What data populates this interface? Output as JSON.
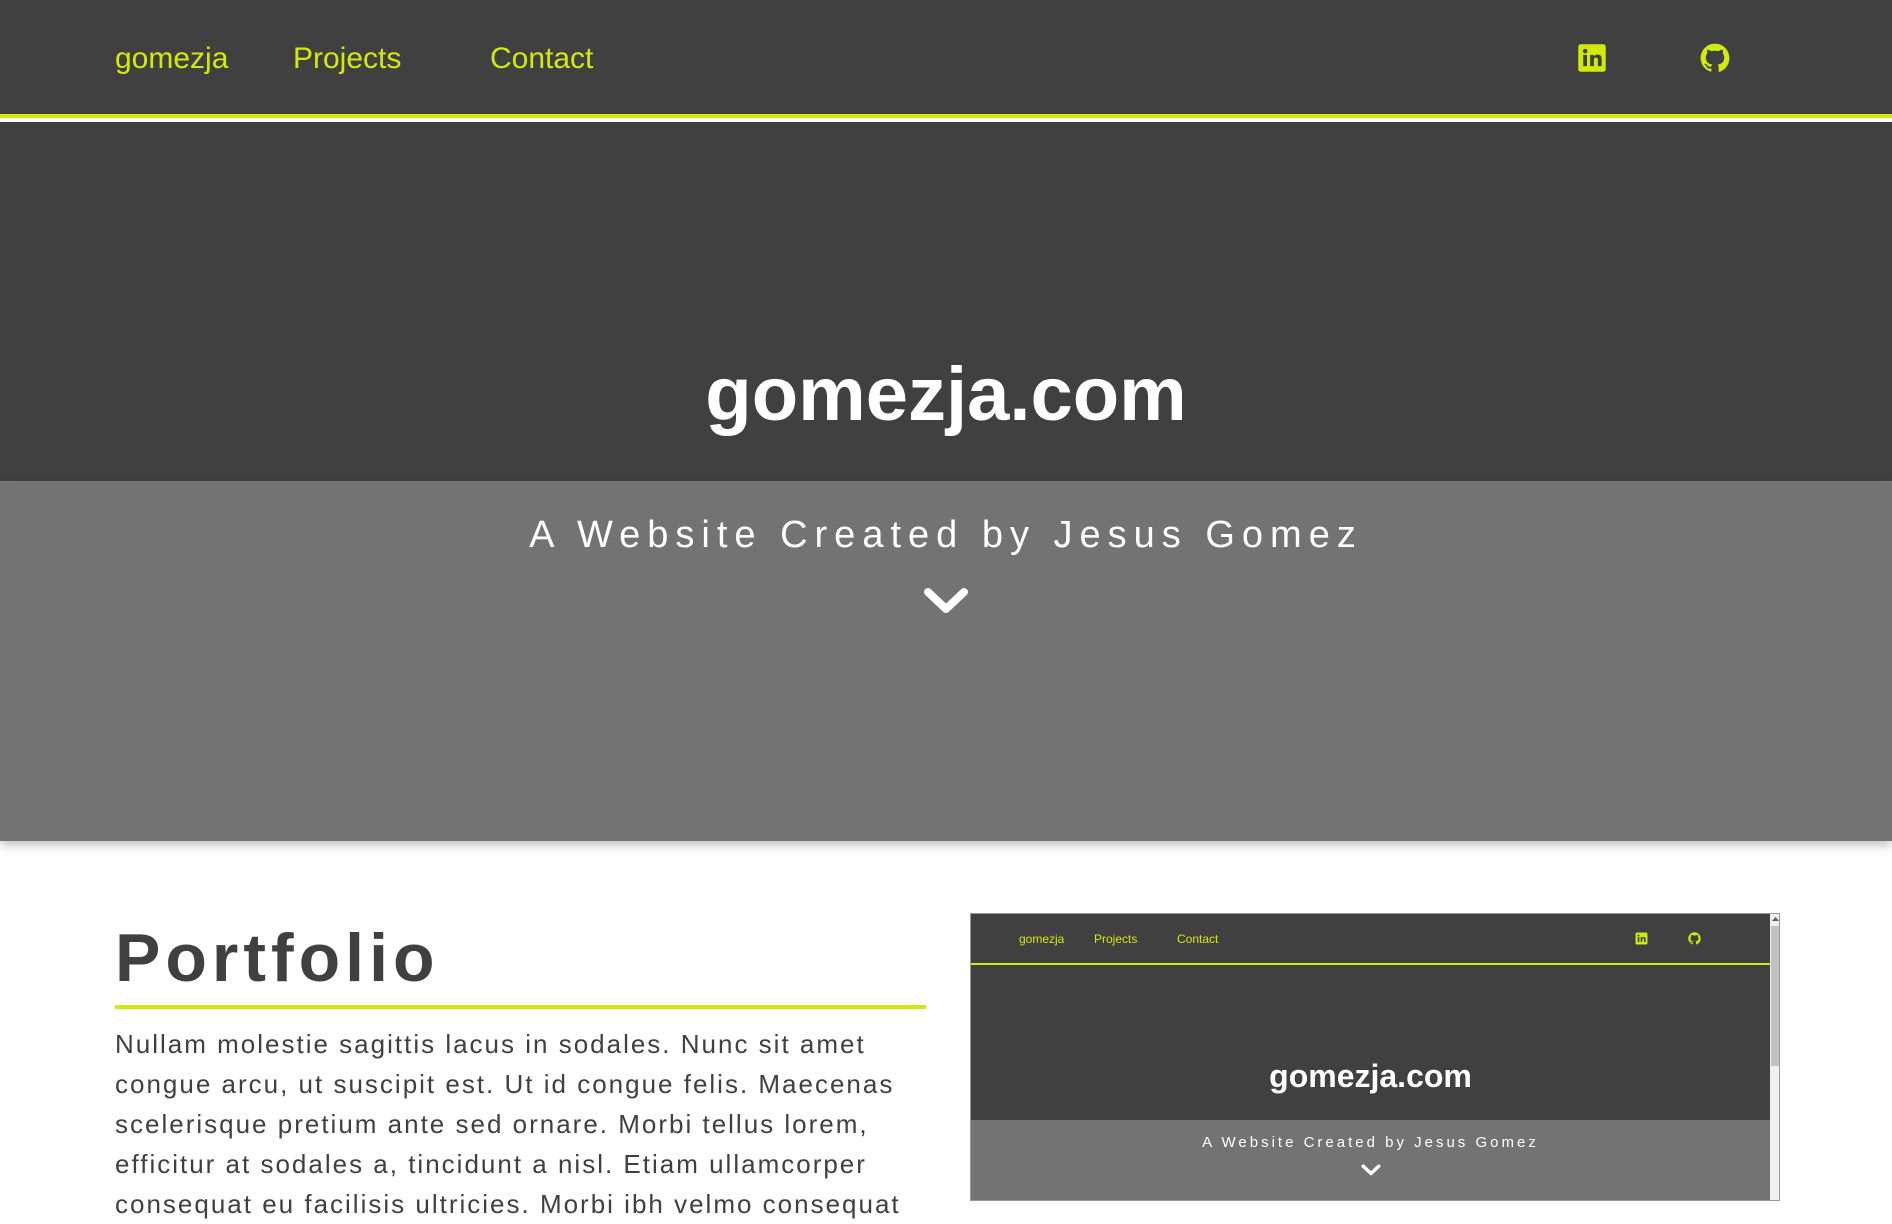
{
  "nav": {
    "brand": "gomezja",
    "links": [
      "Projects",
      "Contact"
    ],
    "icons": [
      "linkedin-icon",
      "github-icon"
    ]
  },
  "hero": {
    "title": "gomezja.com",
    "subtitle": "A Website Created by Jesus Gomez",
    "scroll_icon": "chevron-down-icon"
  },
  "portfolio": {
    "heading": "Portfolio",
    "body": "Nullam molestie sagittis lacus in sodales. Nunc sit amet congue arcu, ut suscipit est. Ut id congue felis. Maecenas scelerisque pretium ante sed ornare. Morbi tellus lorem, efficitur at sodales a, tincidunt a nisl. Etiam ullamcorper consequat eu facilisis ultricies. Morbi ibh velmo consequat"
  },
  "preview": {
    "nav": {
      "brand": "gomezja",
      "links": [
        "Projects",
        "Contact"
      ]
    },
    "title": "gomezja.com",
    "subtitle": "A Website Created by Jesus Gomez"
  },
  "colors": {
    "accent": "#d1ea0b",
    "dark": "#404040",
    "mid": "#737373",
    "text": "#404040",
    "white": "#ffffff"
  }
}
